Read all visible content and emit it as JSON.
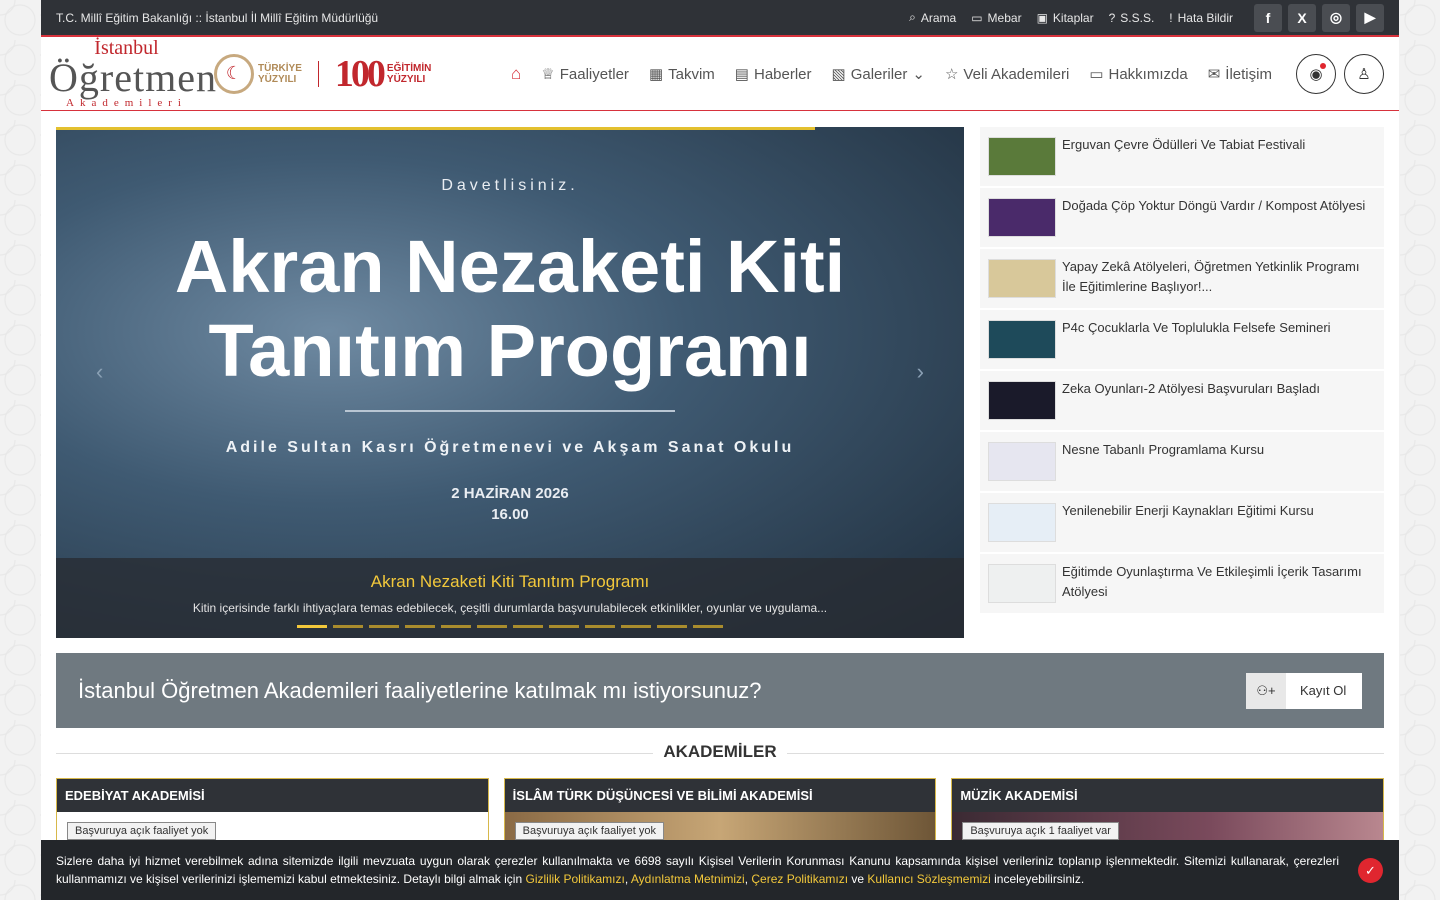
{
  "topbar": {
    "breadcrumb": "T.C. Millî Eğitim Bakanlığı :: İstanbul İl Millî Eğitim Müdürlüğü",
    "links": [
      {
        "icon": "search-icon",
        "glyph": "⌕",
        "label": "Arama"
      },
      {
        "icon": "mebar-icon",
        "glyph": "▭",
        "label": "Mebar"
      },
      {
        "icon": "book-icon",
        "glyph": "▣",
        "label": "Kitaplar"
      },
      {
        "icon": "question-icon",
        "glyph": "?",
        "label": "S.S.S."
      },
      {
        "icon": "alert-icon",
        "glyph": "!",
        "label": "Hata Bildir"
      }
    ],
    "social": [
      {
        "icon": "facebook-icon",
        "glyph": "f"
      },
      {
        "icon": "x-icon",
        "glyph": "X"
      },
      {
        "icon": "instagram-icon",
        "glyph": "◎"
      },
      {
        "icon": "youtube-icon",
        "glyph": "▶"
      }
    ]
  },
  "logo": {
    "line1": "İstanbul",
    "line2": "Öğretmen",
    "line3": "Akademileri",
    "turkiye": "TÜRKİYE",
    "yuzyili": "YÜZYILI",
    "hundred": "100",
    "egitimin": "EĞİTİMİN",
    "yuzyili2": "YÜZYILI"
  },
  "nav": {
    "items": [
      {
        "icon": "trophy-icon",
        "glyph": "♕",
        "label": "Faaliyetler"
      },
      {
        "icon": "calendar-icon",
        "glyph": "▦",
        "label": "Takvim"
      },
      {
        "icon": "news-icon",
        "glyph": "▤",
        "label": "Haberler"
      },
      {
        "icon": "gallery-icon",
        "glyph": "▧",
        "label": "Galeriler"
      },
      {
        "icon": "star-icon",
        "glyph": "☆",
        "label": "Veli Akademileri"
      },
      {
        "icon": "id-card-icon",
        "glyph": "▭",
        "label": "Hakkımızda"
      },
      {
        "icon": "mail-icon",
        "glyph": "✉",
        "label": "İletişim"
      }
    ]
  },
  "slider": {
    "invite": "Davetlisiniz.",
    "headline1": "Akran Nezaketi Kiti",
    "headline2": "Tanıtım Programı",
    "venue": "Adile Sultan Kasrı Öğretmenevi ve Akşam Sanat Okulu",
    "date": "2 HAZİRAN 2026",
    "time": "16.00",
    "caption_title": "Akran Nezaketi Kiti Tanıtım Programı",
    "caption_desc": "Kitin içerisinde farklı ihtiyaçlara temas edebilecek, çeşitli durumlarda başvurulabilecek etkinlikler, oyunlar ve uygulama..."
  },
  "news": [
    {
      "title": "Erguvan Çevre Ödülleri Ve Tabiat Festivali",
      "color": "#5a7a3a"
    },
    {
      "title": "Doğada Çöp Yoktur Döngü Vardır / Kompost Atölyesi",
      "color": "#4a2a6a"
    },
    {
      "title": "Yapay Zekâ Atölyeleri, Öğretmen Yetkinlik Programı İle Eğitimlerine Başlıyor!...",
      "color": "#d8c89a"
    },
    {
      "title": "P4c Çocuklarla Ve Toplulukla Felsefe Semineri",
      "color": "#1e4a5a"
    },
    {
      "title": "Zeka Oyunları-2 Atölyesi Başvuruları Başladı",
      "color": "#1a1a2a"
    },
    {
      "title": "Nesne Tabanlı Programlama Kursu",
      "color": "#e6e6f0"
    },
    {
      "title": "Yenilenebilir Enerji Kaynakları Eğitimi Kursu",
      "color": "#e6eef6"
    },
    {
      "title": "Eğitimde Oyunlaştırma Ve Etkileşimli İçerik Tasarımı Atölyesi",
      "color": "#eef0f0"
    }
  ],
  "cta": {
    "question": "İstanbul Öğretmen Akademileri faaliyetlerine katılmak mı istiyorsunuz?",
    "button": "Kayıt Ol"
  },
  "academies": {
    "title": "AKADEMİLER",
    "cards": [
      {
        "name": "EDEBİYAT AKADEMİSİ",
        "badge": "Başvuruya açık faaliyet yok"
      },
      {
        "name": "İSLÂM TÜRK DÜŞÜNCESİ VE BİLİMİ AKADEMİSİ",
        "badge": "Başvuruya açık faaliyet yok"
      },
      {
        "name": "MÜZİK AKADEMİSİ",
        "badge": "Başvuruya açık 1 faaliyet var"
      }
    ]
  },
  "cookie": {
    "text1": "Sizlere daha iyi hizmet verebilmek adına sitemizde ilgili mevzuata uygun olarak çerezler kullanılmakta ve 6698 sayılı Kişisel Verilerin Korunması Kanunu kapsamında kişisel verileriniz toplanıp işlenmektedir. Sitemizi kullanarak, çerezleri kullanmamızı ve kişisel verilerinizi işlememizi kabul etmektesiniz. Detaylı bilgi almak için ",
    "link1": "Gizlilik Politikamızı",
    "sep1": ", ",
    "link2": "Aydınlatma Metnimizi",
    "sep2": ", ",
    "link3": "Çerez Politikamızı",
    "sep3": " ve ",
    "link4": "Kullanıcı Sözleşmemizi",
    "text2": " inceleyebilirsiniz."
  }
}
